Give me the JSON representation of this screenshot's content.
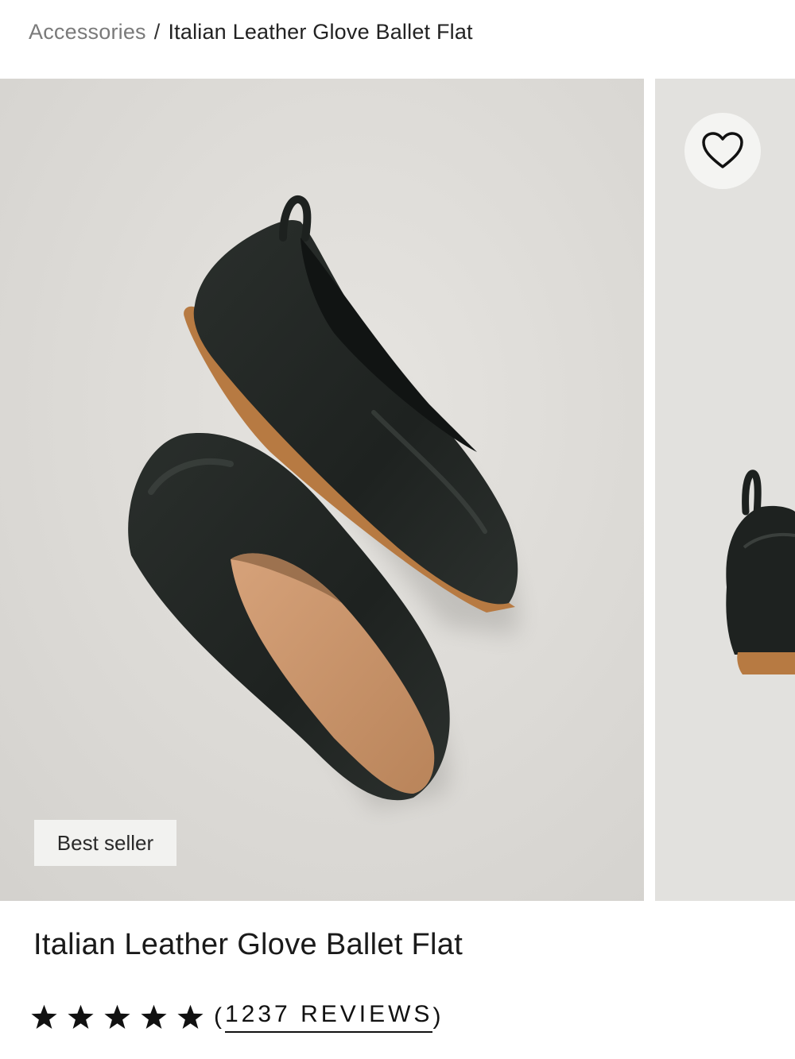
{
  "breadcrumb": {
    "parent": "Accessories",
    "separator": "/",
    "current": "Italian Leather Glove Ballet Flat"
  },
  "gallery": {
    "badge": "Best seller",
    "favorite_icon": "heart-outline-icon"
  },
  "product": {
    "title": "Italian Leather Glove Ballet Flat",
    "rating": 5,
    "reviews_open": "(",
    "reviews_text": "1237 REVIEWS",
    "reviews_close": ")"
  },
  "colors": {
    "photo_background": "#dedcd8",
    "leather": "#1f2321",
    "sole": "#b77a42",
    "insole": "#c8936a"
  }
}
